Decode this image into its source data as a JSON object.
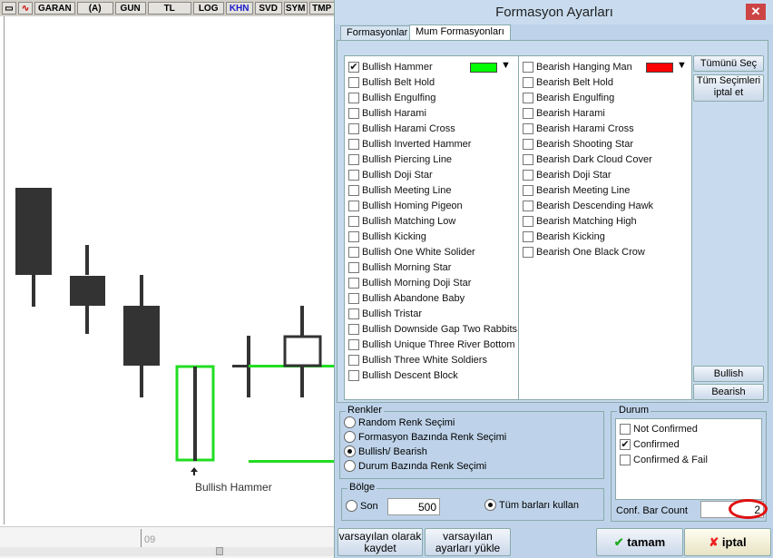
{
  "toolbar": {
    "symbol": "GARAN",
    "items": [
      "(A)",
      "GUN",
      "TL",
      "LOG",
      "KHN",
      "SVD",
      "SYM",
      "TMP"
    ],
    "active": "KHN"
  },
  "chart": {
    "annotation": "Bullish Hammer",
    "time_label": "09"
  },
  "dialog": {
    "title": "Formasyon Ayarları",
    "tabs": [
      "Formasyonlar",
      "Mum Formasyonları"
    ],
    "active_tab": "Mum Formasyonları",
    "bullish": [
      "Bullish Hammer",
      "Bullish Belt Hold",
      "Bullish Engulfing",
      "Bullish Harami",
      "Bullish Harami Cross",
      "Bullish Inverted Hammer",
      "Bullish Piercing Line",
      "Bullish Doji Star",
      "Bullish Meeting Line",
      "Bullish Homing Pigeon",
      "Bullish Matching Low",
      "Bullish Kicking",
      "Bullish One White Solider",
      "Bullish Morning Star",
      "Bullish Morning Doji Star",
      "Bullish Abandone Baby",
      "Bullish Tristar",
      "Bullish Downside Gap Two Rabbits",
      "Bullish Unique Three River Bottom",
      "Bullish Three White Soldiers",
      "Bullish Descent Block"
    ],
    "bullish_checked": [
      "Bullish Hammer"
    ],
    "bullish_color": "#00ff00",
    "bearish": [
      "Bearish Hanging Man",
      "Bearish Belt Hold",
      "Bearish Engulfing",
      "Bearish Harami",
      "Bearish Harami Cross",
      "Bearish Shooting Star",
      "Bearish Dark Cloud Cover",
      "Bearish Doji Star",
      "Bearish Meeting Line",
      "Bearish Descending Hawk",
      "Bearish Matching High",
      "Bearish Kicking",
      "Bearish One Black Crow"
    ],
    "bearish_color": "#ff0000",
    "side_buttons": {
      "select_all": "Tümünü Seç",
      "deselect_all": "Tüm Seçimleri iptal et",
      "bullish": "Bullish",
      "bearish": "Bearish"
    },
    "renkler": {
      "label": "Renkler",
      "options": [
        "Random Renk Seçimi",
        "Formasyon Bazında Renk Seçimi",
        "Bullish/ Bearish",
        "Durum Bazında Renk Seçimi"
      ],
      "selected": 2
    },
    "bolge": {
      "label": "Bölge",
      "son_label": "Son",
      "son_value": "500",
      "all_label": "Tüm barları kullan",
      "selected": "all"
    },
    "durum": {
      "label": "Durum",
      "options": [
        "Not Confirmed",
        "Confirmed",
        "Confirmed & Fail"
      ],
      "checked": [
        1
      ],
      "conf_label": "Conf. Bar Count",
      "conf_value": "2"
    },
    "buttons": {
      "save_default": "varsayılan olarak kaydet",
      "load_default": "varsayılan ayarları yükle",
      "ok": "tamam",
      "cancel": "iptal"
    }
  }
}
